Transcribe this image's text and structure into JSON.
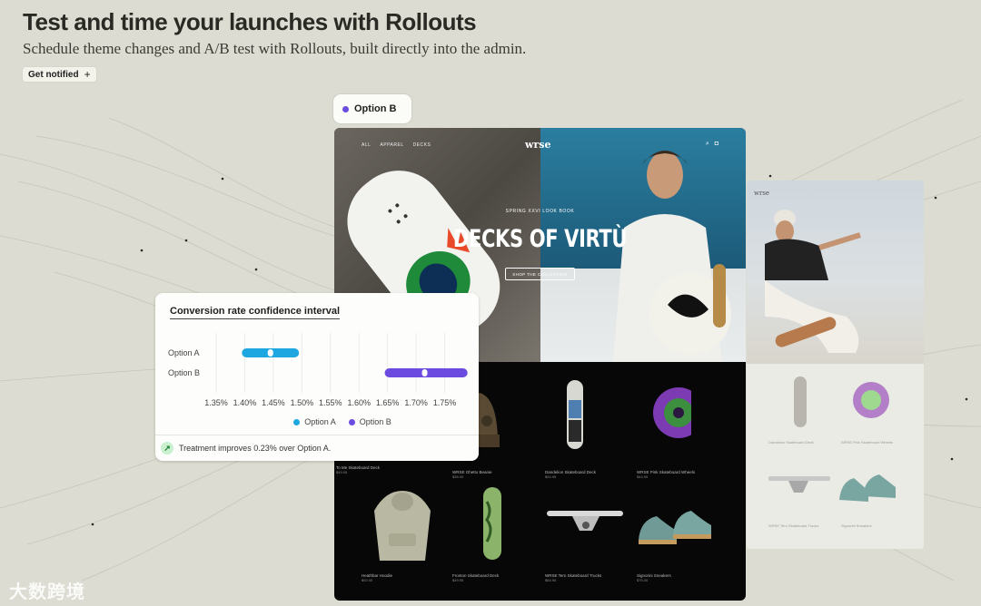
{
  "header": {
    "title": "Test and time your launches with Rollouts",
    "subtitle": "Schedule theme changes and A/B test with Rollouts, built directly into the admin.",
    "notify_label": "Get notified",
    "notify_icon": "plus-icon"
  },
  "option_pill": {
    "label": "Option B",
    "color": "#6b4be0"
  },
  "storefront": {
    "nav": [
      "ALL",
      "APPAREL",
      "DECKS"
    ],
    "logo": "wrse",
    "icons": [
      "search-icon",
      "bag-icon"
    ],
    "lookbook": "SPRING XXVI LOOK BOOK",
    "headline": "DECKS OF VIRTÙ",
    "cta": "SHOP THE COLLECTION",
    "products": [
      {
        "name": "To Me Skateboard Deck",
        "price": "$49.95"
      },
      {
        "name": "WRSE Ghetto Beanie",
        "price": "$35.00"
      },
      {
        "name": "Dandelion Skateboard Deck",
        "price": "$54.95"
      },
      {
        "name": "WRSE Pink Skateboard Wheels",
        "price": "$44.95"
      },
      {
        "name": "Heathbar Hoodie",
        "price": "$92.00"
      },
      {
        "name": "Fronton Skateboard Deck",
        "price": "$49.95"
      },
      {
        "name": "WRSE Tern Skateboard Trucks",
        "price": "$64.95"
      },
      {
        "name": "Signorini Sneakers",
        "price": "$75.00"
      }
    ]
  },
  "storefront_b": {
    "logo": "wrse",
    "products": [
      {
        "name": "Dandelion Skateboard Deck"
      },
      {
        "name": "WRSE Pink Skateboard Wheels"
      },
      {
        "name": "WRSE Tern Skateboard Trucks"
      },
      {
        "name": "Signorini Sneakers"
      }
    ]
  },
  "chart_card": {
    "title": "Conversion rate confidence interval",
    "footer_text": "Treatment improves 0.23% over Option A.",
    "footer_icon": "arrow-up-right-icon"
  },
  "chart_data": {
    "type": "interval",
    "title": "Conversion rate confidence interval",
    "categories": [
      "Option A",
      "Option B"
    ],
    "series": [
      {
        "name": "Option A",
        "low": 1.395,
        "high": 1.495,
        "point": 1.445,
        "color": "#1ea7e0"
      },
      {
        "name": "Option B",
        "low": 1.645,
        "high": 1.79,
        "point": 1.715,
        "color": "#6b4be0"
      }
    ],
    "xticks": [
      "1.35%",
      "1.40%",
      "1.45%",
      "1.50%",
      "1.55%",
      "1.60%",
      "1.65%",
      "1.70%",
      "1.75%"
    ],
    "xlim": [
      1.35,
      1.8
    ],
    "grid": true,
    "legend": "bottom"
  },
  "watermark": "大数跨境"
}
